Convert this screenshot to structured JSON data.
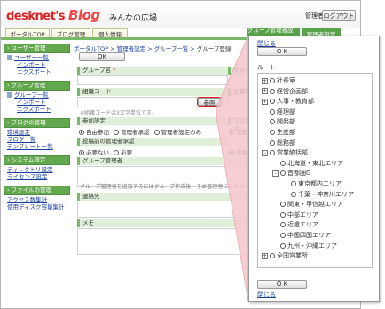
{
  "app": {
    "logo_text": "desknet's",
    "logo_blog": "Blog",
    "title": "みんなの広場",
    "user_role": "管理者",
    "logout_label": "ログアウト"
  },
  "tabs": [
    "ポータルTOP",
    "ブログ管理",
    "個人情報",
    "グループ管理者設定",
    "管理者設定"
  ],
  "sidebar": {
    "sections": [
      {
        "head": "ユーザー管理",
        "links": [
          "ユーザー一覧",
          "インポート",
          "エクスポート"
        ]
      },
      {
        "head": "グループ管理",
        "links": [
          "グループ一覧",
          "インポート",
          "エクスポート"
        ]
      },
      {
        "head": "ブログの管理",
        "links": [
          "環境設定",
          "ブログ一覧",
          "テンプレート一覧"
        ]
      },
      {
        "head": "システム設定",
        "links": [
          "ディレクトリ設定",
          "ライセンス設定"
        ]
      },
      {
        "head": "ファイルの管理",
        "links": [
          "アクセス数集計",
          "使用ディスク容量集計"
        ]
      }
    ]
  },
  "main": {
    "breadcrumb": [
      "ポータルTOP",
      "管理者設定",
      "グループ一覧",
      "グループ登録"
    ],
    "ok_label": "OK",
    "group_name_label": "グループ名",
    "group_label_right": "グルー",
    "org_code_label": "組織コード",
    "ref_button": "参照",
    "org_code_note": "※組織コードは3文字単位です。",
    "company_label_right": "企業内",
    "join_setting_label": "参加設定",
    "join_options": [
      "自由参加",
      "管理者承認",
      "管理者設定のみ"
    ],
    "blog_label_right": "ブログの",
    "right_opt1": "制限",
    "admin_approval_label": "投稿前の管理者承認",
    "approval_options": [
      "必要ない",
      "必要"
    ],
    "right_opt2": "投稿",
    "group_admin_label": "グループ管理者",
    "group_admin_note": "グループ管理者を追加するにはグループ作成後、予め管理者にしたい",
    "contact_label": "連絡先",
    "memo_label": "メモ"
  },
  "popup": {
    "close_label": "閉じる",
    "ok_label": "O K",
    "root_label": "ルート",
    "tree": [
      {
        "label": "社長室",
        "level": 0,
        "toggle": "+"
      },
      {
        "label": "経営企画部",
        "level": 0,
        "toggle": "+"
      },
      {
        "label": "人事・教育部",
        "level": 0,
        "toggle": "+"
      },
      {
        "label": "経理部",
        "level": 0,
        "toggle": ""
      },
      {
        "label": "開発部",
        "level": 0,
        "toggle": ""
      },
      {
        "label": "生産部",
        "level": 0,
        "toggle": ""
      },
      {
        "label": "総務部",
        "level": 0,
        "toggle": ""
      },
      {
        "label": "営業統括部",
        "level": 0,
        "toggle": "-"
      },
      {
        "label": "北海道・東北エリア",
        "level": 1,
        "toggle": ""
      },
      {
        "label": "首都圏G",
        "level": 1,
        "toggle": "-"
      },
      {
        "label": "東京都内エリア",
        "level": 2,
        "toggle": ""
      },
      {
        "label": "千葉・神奈川エリア",
        "level": 2,
        "toggle": ""
      },
      {
        "label": "関東・甲信越エリア",
        "level": 1,
        "toggle": ""
      },
      {
        "label": "中部エリア",
        "level": 1,
        "toggle": ""
      },
      {
        "label": "近畿エリア",
        "level": 1,
        "toggle": ""
      },
      {
        "label": "中国四国エリア",
        "level": 1,
        "toggle": ""
      },
      {
        "label": "九州・沖縄エリア",
        "level": 1,
        "toggle": ""
      },
      {
        "label": "全国営業所",
        "level": 0,
        "toggle": "+"
      }
    ]
  },
  "colors": {
    "accent_green": "#63a84f",
    "highlight_pink": "#f4c6cc",
    "logo_red": "#d22222"
  }
}
